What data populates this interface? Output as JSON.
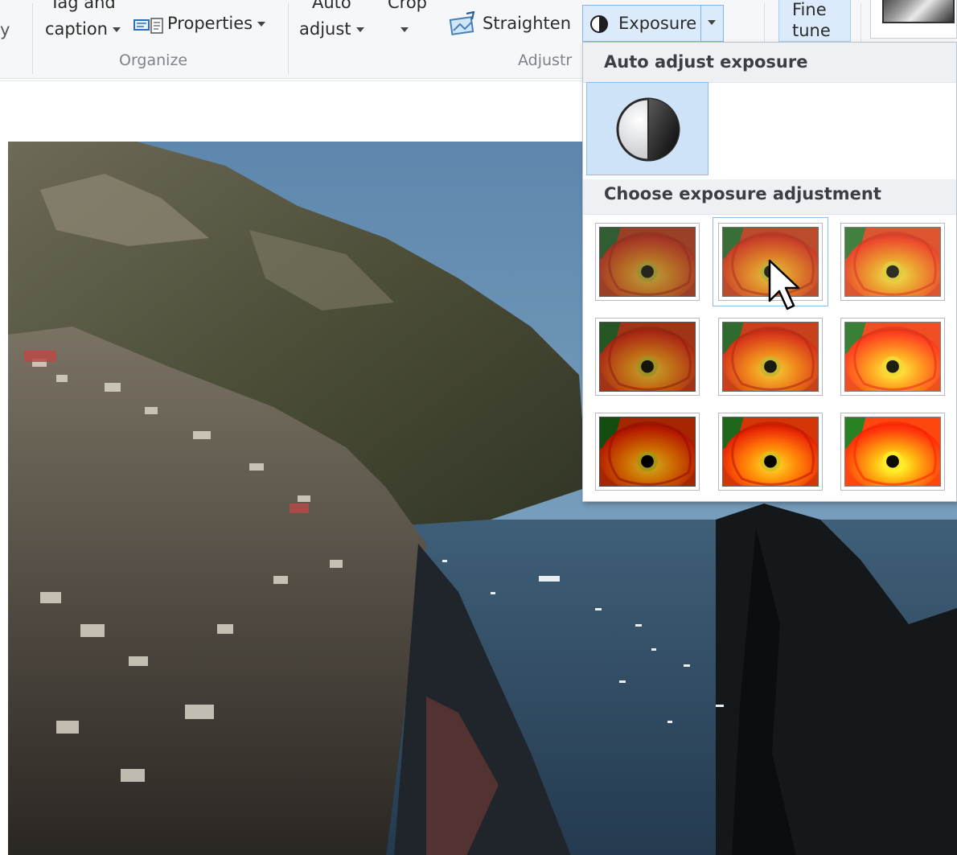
{
  "ribbon": {
    "left_cut_label": "y",
    "tag_line1": "Tag and",
    "tag_line2": "caption",
    "properties": "Properties",
    "organize_group": "Organize",
    "auto_line1": "Auto",
    "auto_line2": "adjust",
    "crop_label": "Crop",
    "straighten": "Straighten",
    "exposure": "Exposure",
    "adjust_group": "Adjustr",
    "fine_line1": "Fine",
    "fine_line2": "tune"
  },
  "menu": {
    "auto_header": "Auto adjust exposure",
    "choose_header": "Choose exposure adjustment",
    "presets": [
      {
        "brightness": 0.8,
        "contrast": 0.85
      },
      {
        "brightness": 1.0,
        "contrast": 0.85
      },
      {
        "brightness": 1.2,
        "contrast": 0.85
      },
      {
        "brightness": 0.8,
        "contrast": 1.0
      },
      {
        "brightness": 1.0,
        "contrast": 1.0
      },
      {
        "brightness": 1.2,
        "contrast": 1.0
      },
      {
        "brightness": 0.8,
        "contrast": 1.2
      },
      {
        "brightness": 1.0,
        "contrast": 1.2
      },
      {
        "brightness": 1.2,
        "contrast": 1.2
      }
    ],
    "hovered_preset": 2
  },
  "icons": {
    "exposure": "exposure-half-circle-icon",
    "properties": "properties-icon",
    "straighten": "straighten-icon",
    "cursor": "mouse-pointer-icon"
  }
}
